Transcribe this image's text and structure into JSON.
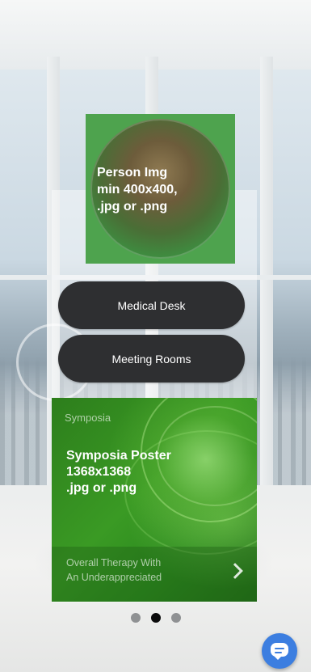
{
  "person": {
    "placeholder_label": "Person Img\nmin 400x400,\n.jpg or .png"
  },
  "buttons": [
    {
      "label": "Medical Desk"
    },
    {
      "label": "Meeting Rooms"
    }
  ],
  "poster": {
    "category": "Symposia",
    "title": "Symposia Poster\n1368x1368\n.jpg or .png",
    "footer_text": "Overall Therapy With\nAn Underappreciated",
    "chevron_icon": "chevron-right-icon"
  },
  "pagination": {
    "count": 3,
    "active_index": 1
  },
  "chat": {
    "icon": "chat-bubble-icon",
    "color": "#3c7ee0"
  },
  "colors": {
    "accent_green": "#4ea34e",
    "button_dark": "#2e2f31"
  }
}
